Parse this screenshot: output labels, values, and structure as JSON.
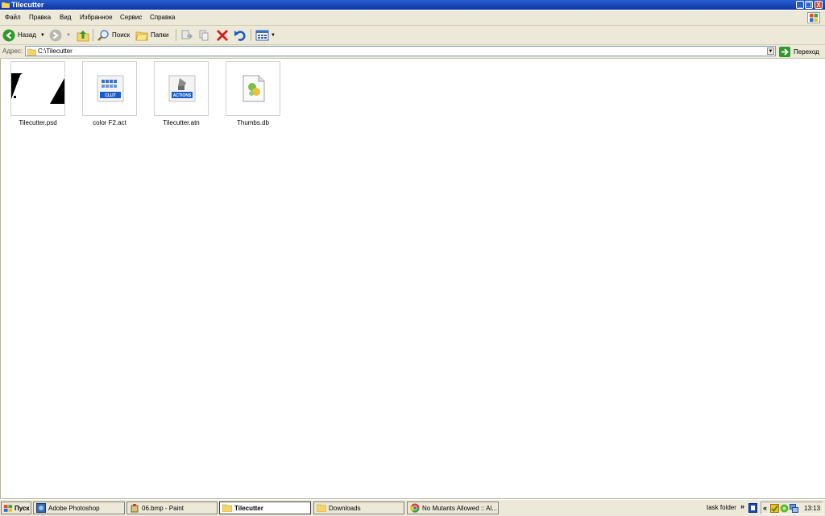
{
  "window": {
    "title": "Tilecutter",
    "controls": {
      "minimize": "_",
      "restore": "❐",
      "close": "X"
    }
  },
  "menu": [
    "Файл",
    "Правка",
    "Вид",
    "Избранное",
    "Сервис",
    "Справка"
  ],
  "toolbar": {
    "back_label": "Назад",
    "search_label": "Поиск",
    "folders_label": "Папки"
  },
  "address": {
    "label": "Адрес:",
    "path": "C:\\Tilecutter",
    "go_label": "Переход"
  },
  "files": [
    {
      "name": "Tilecutter.psd",
      "kind": "psd-thumbnail"
    },
    {
      "name": "color F2.act",
      "kind": "clut-icon",
      "badge": "CLUT"
    },
    {
      "name": "Tilecutter.atn",
      "kind": "actions-icon",
      "badge": "ACTIONS"
    },
    {
      "name": "Thumbs.db",
      "kind": "db-icon"
    }
  ],
  "taskbar": {
    "start_label": "Пуск",
    "tasks": [
      {
        "label": "Adobe Photoshop",
        "active": false
      },
      {
        "label": "06.bmp - Paint",
        "active": false
      },
      {
        "label": "Tilecutter",
        "active": true
      },
      {
        "label": "Downloads",
        "active": false
      },
      {
        "label": "No Mutants Allowed :: Al...",
        "active": false
      }
    ],
    "toolbar_name": "task folder",
    "chevron": "»",
    "tray_chevron": "«",
    "clock": "13:13"
  },
  "colors": {
    "titlebar": "#0c36a0",
    "chrome": "#ece9d8",
    "back_green": "#2e9a2e",
    "delete_red": "#d42020",
    "undo_blue": "#1a5cc8"
  }
}
